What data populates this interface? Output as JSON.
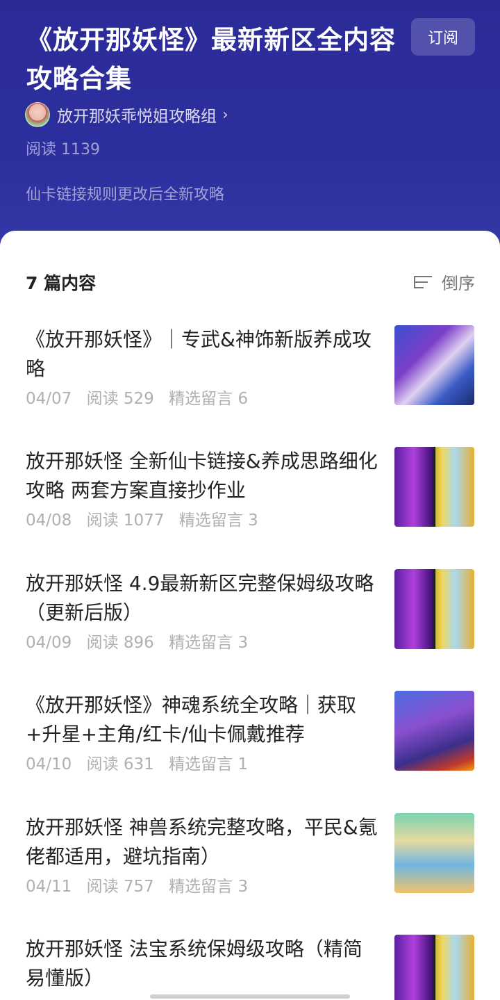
{
  "header": {
    "title": "《放开那妖怪》最新新区全内容攻略合集",
    "subscribe_label": "订阅",
    "author": "放开那妖乖悦姐攻略组",
    "author_chevron": "›",
    "read_count": "阅读 1139",
    "description": "仙卡链接规则更改后全新攻略"
  },
  "list": {
    "count_label": "7 篇内容",
    "sort_label": "倒序",
    "items": [
      {
        "title": "《放开那妖怪》｜专武&神饰新版养成攻略",
        "date": "04/07",
        "reads": "阅读 529",
        "comments": "精选留言 6",
        "thumb_icon": "game-screenshot"
      },
      {
        "title": " 放开那妖怪 全新仙卡链接&养成思路细化攻略 两套方案直接抄作业",
        "date": "04/08",
        "reads": "阅读 1077",
        "comments": "精选留言 3",
        "thumb_icon": "card-pair"
      },
      {
        "title": " 放开那妖怪  4.9最新新区完整保姆级攻略（更新后版）",
        "date": "04/09",
        "reads": "阅读 896",
        "comments": "精选留言 3",
        "thumb_icon": "card-pair"
      },
      {
        "title": "《放开那妖怪》神魂系统全攻略｜获取+升星+主角/红卡/仙卡佩戴推荐",
        "date": "04/10",
        "reads": "阅读 631",
        "comments": "精选留言 1",
        "thumb_icon": "soul-screenshot"
      },
      {
        "title": " 放开那妖怪 神兽系统完整攻略，平民&氪佬都适用，避坑指南）",
        "date": "04/11",
        "reads": "阅读 757",
        "comments": "精选留言 3",
        "thumb_icon": "beast-screenshot"
      },
      {
        "title": " 放开那妖怪  法宝系统保姆级攻略（精简易懂版）",
        "date": "",
        "reads": "",
        "comments": "",
        "thumb_icon": "card-pair"
      }
    ]
  }
}
